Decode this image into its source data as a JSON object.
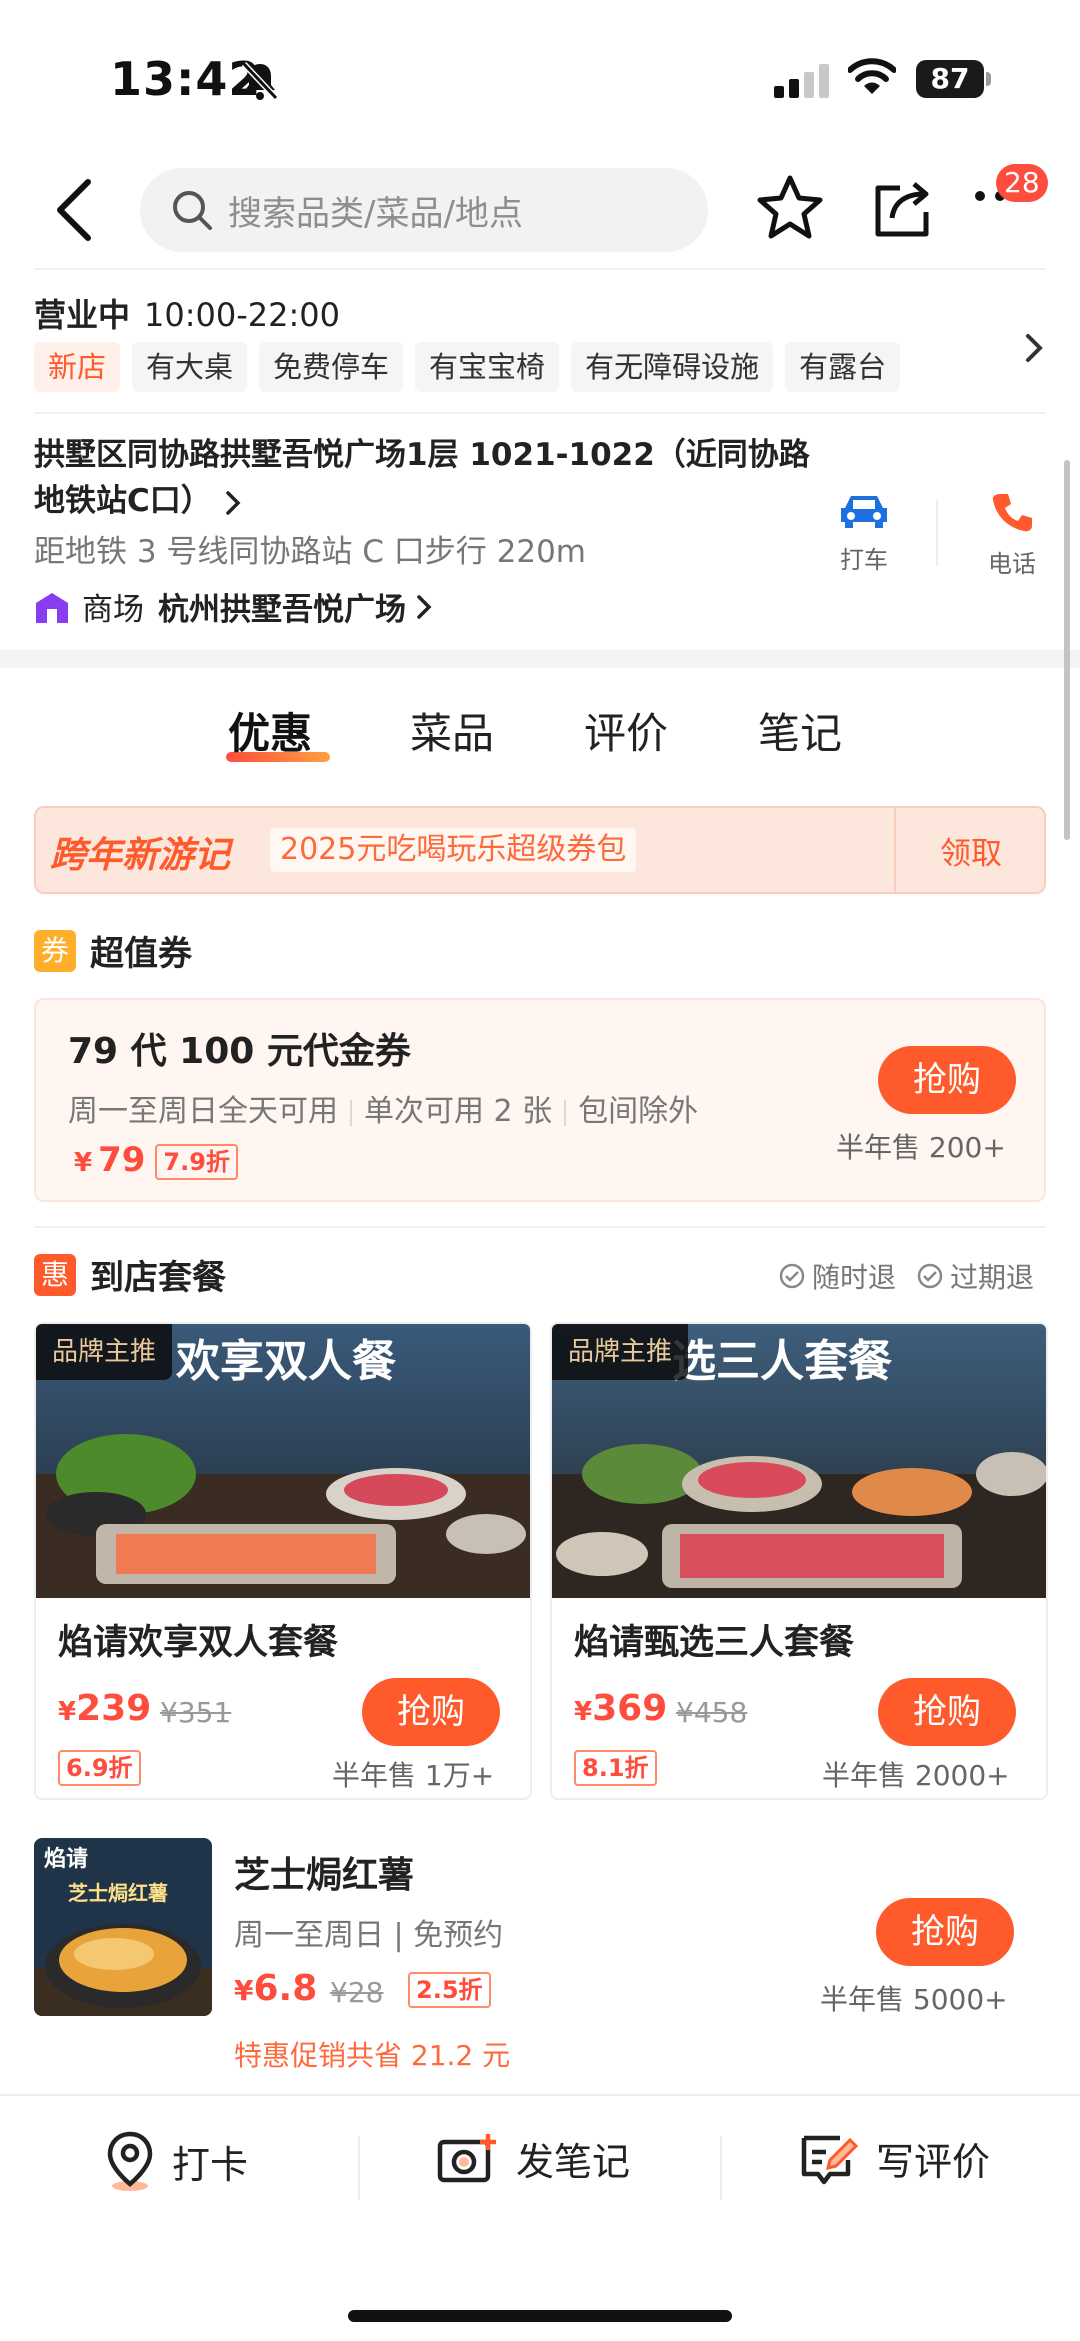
{
  "status_bar": {
    "time": "13:42",
    "battery": "87"
  },
  "search": {
    "placeholder": "搜索品类/菜品/地点",
    "notification_count": "28"
  },
  "store": {
    "hours_status": "营业中",
    "hours": "10:00-22:00",
    "tags": [
      "新店",
      "有大桌",
      "免费停车",
      "有宝宝椅",
      "有无障碍设施",
      "有露台"
    ],
    "address": "拱墅区同协路拱墅吾悦广场1层 1021-1022（近同协路地铁站C口）",
    "distance": "距地铁 3 号线同协路站 C 口步行 220m",
    "mall_label": "商场",
    "mall_name": "杭州拱墅吾悦广场",
    "actions": {
      "taxi": "打车",
      "phone": "电话"
    }
  },
  "tabs": [
    "优惠",
    "菜品",
    "评价",
    "笔记"
  ],
  "promo": {
    "title": "跨年新游记",
    "subtitle": "2025元吃喝玩乐超级券包",
    "claim": "领取"
  },
  "voucher_section": {
    "icon_text": "券",
    "title": "超值券",
    "card": {
      "title": "79 代 100 元代金券",
      "conditions": [
        "周一至周日全天可用",
        "单次可用 2 张",
        "包间除外"
      ],
      "currency": "¥",
      "price": "79",
      "discount": "7.9折",
      "buy": "抢购",
      "sold": "半年售 200+"
    }
  },
  "meal_section": {
    "icon_text": "惠",
    "title": "到店套餐",
    "refund_any": "随时退",
    "refund_expired": "过期退",
    "meals": [
      {
        "badge": "品牌主推",
        "image_text": "欢享双人餐",
        "name": "焰请欢享双人套餐",
        "currency": "¥",
        "price": "239",
        "original": "¥351",
        "discount": "6.9折",
        "buy": "抢购",
        "sold": "半年售 1万+"
      },
      {
        "badge": "品牌主推",
        "image_text": "选三人套餐",
        "name": "焰请甄选三人套餐",
        "currency": "¥",
        "price": "369",
        "original": "¥458",
        "discount": "8.1折",
        "buy": "抢购",
        "sold": "半年售 2000+"
      }
    ]
  },
  "single_item": {
    "thumb_brand": "焰请",
    "thumb_title": "芝士焗红薯",
    "name": "芝士焗红薯",
    "desc": "周一至周日 | 免预约",
    "currency": "¥",
    "price": "6.8",
    "original": "¥28",
    "discount": "2.5折",
    "savings": "特惠促销共省 21.2 元",
    "buy": "抢购",
    "sold": "半年售 5000+"
  },
  "bottom_bar": {
    "checkin": "打卡",
    "post_note": "发笔记",
    "write_review": "写评价"
  },
  "colors": {
    "accent": "#ff5a2c",
    "price": "#ff4d3d",
    "voucher_bg": "#fff6f2"
  }
}
